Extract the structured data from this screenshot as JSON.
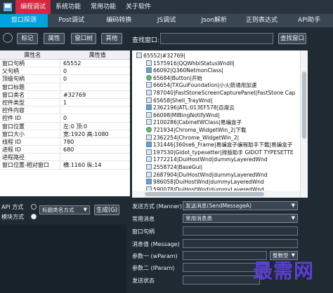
{
  "menu": {
    "items": [
      "编程调试",
      "系统功能",
      "常用功能",
      "关于软件"
    ],
    "active_index": 0
  },
  "tabs": [
    {
      "label": "窗口探测",
      "active": true
    },
    {
      "label": "Post调试"
    },
    {
      "label": "编码转换"
    },
    {
      "label": "JS调试"
    },
    {
      "label": "Json解析"
    },
    {
      "label": "正则表达式"
    },
    {
      "label": "API助手"
    }
  ],
  "toolbar": {
    "buttons": [
      "标记",
      "属性",
      "窗口树",
      "其他"
    ],
    "search_label": "查找窗口:",
    "search_button": "查找窗口"
  },
  "property_table": {
    "headers": [
      "属性名",
      "属性值"
    ],
    "rows": [
      {
        "k": "窗口句柄",
        "v": "65552"
      },
      {
        "k": "父句柄",
        "v": "0"
      },
      {
        "k": "顶级句柄",
        "v": "0"
      },
      {
        "k": "窗口标题",
        "v": ""
      },
      {
        "k": "窗口类名",
        "v": "#32769"
      },
      {
        "k": "控件类型",
        "v": "1"
      },
      {
        "k": "控件内容",
        "v": ""
      },
      {
        "k": "控件 ID",
        "v": "0"
      },
      {
        "k": "窗口位置",
        "v": "左:0 顶:0"
      },
      {
        "k": "窗口大小",
        "v": "宽:1920 高:1080"
      },
      {
        "k": "线程 ID",
        "v": "780"
      },
      {
        "k": "进程 ID",
        "v": "680"
      },
      {
        "k": "进程路径",
        "v": ""
      },
      {
        "k": "窗口位置-相对窗口",
        "v": "横:1160 纵:14"
      }
    ]
  },
  "tree": {
    "rows": [
      "65552|#32769|",
      "1575916|QQWhbiStatusWndII|",
      "66092|Q360NetmonClass|",
      "65684|Button|开始",
      "66654|TXGuiFoundation|小火箭通用加速",
      "787040|FastStoneScreenCapturePanel|FastStone Cap",
      "65658|Shell_TrayWnd|",
      "2362196|ATL:013EF578|百度云",
      "66098|MIBingNotifyWnd|",
      "2100286|CabinetWClass|易编盒子",
      "721934|Chrome_WidgetWin_2|下载",
      "2362254|Chrome_WidgetWin_2|",
      "131446|360se6_Frame|易编盒子编程助手下载|易编盒子",
      "197530|Gidot_typesetter|排版助手 GIDOT TYPESETTE",
      "1772214|DuiHostWnd|dummyLayeredWnd",
      "2558724|BaseGui|",
      "2687904|DuiHostWnd|dummyLayeredWnd",
      "986058|DuiHostWnd|dummyLayeredWnd",
      "590078|DuiHostWnd|dummyLayeredWnd"
    ]
  },
  "bottom_left": {
    "api_label": "API 方式",
    "mode_label": "模块方式",
    "select_value": "标题类名方式",
    "generate_button": "生成(G)"
  },
  "bottom_right": {
    "send_mode_label": "发送方式 (Manner)",
    "send_mode_value": "发送消息(SendMessageA)",
    "common_msg_label": "常用消息",
    "common_msg_value": "常用消息类",
    "handle_label": "窗口句柄",
    "msg_value_label": "消息值 (Message)",
    "param1_label": "参数一 (wParam)",
    "param1_type": "整数型",
    "param2_label": "参数二 (lParam)",
    "status_label": "发送状态"
  },
  "watermark": "最需网"
}
